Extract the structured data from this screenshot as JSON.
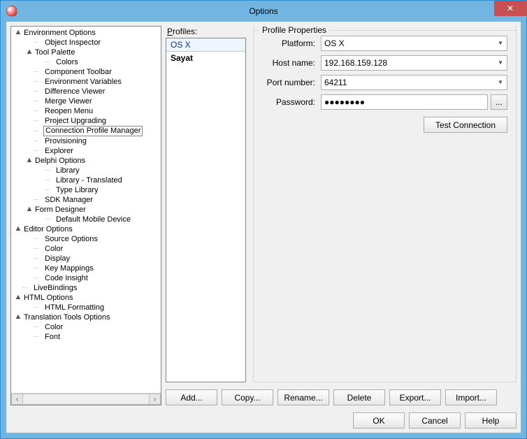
{
  "window": {
    "title": "Options"
  },
  "tree": {
    "selected_label": "Connection Profile Manager",
    "nodes": [
      {
        "label": "Environment Options",
        "depth": 0,
        "expander": "▲",
        "dots": false
      },
      {
        "label": "Object Inspector",
        "depth": 1,
        "expander": "",
        "dots": true
      },
      {
        "label": "Tool Palette",
        "depth": 1,
        "expander": "▲",
        "dots": false
      },
      {
        "label": "Colors",
        "depth": 2,
        "expander": "",
        "dots": true
      },
      {
        "label": "Component Toolbar",
        "depth": 1,
        "expander": "",
        "dots": true
      },
      {
        "label": "Environment Variables",
        "depth": 1,
        "expander": "",
        "dots": true
      },
      {
        "label": "Difference Viewer",
        "depth": 1,
        "expander": "",
        "dots": true
      },
      {
        "label": "Merge Viewer",
        "depth": 1,
        "expander": "",
        "dots": true
      },
      {
        "label": "Reopen Menu",
        "depth": 1,
        "expander": "",
        "dots": true
      },
      {
        "label": "Project Upgrading",
        "depth": 1,
        "expander": "",
        "dots": true
      },
      {
        "label": "Connection Profile Manager",
        "depth": 1,
        "expander": "",
        "dots": true,
        "selected": true
      },
      {
        "label": "Provisioning",
        "depth": 1,
        "expander": "",
        "dots": true
      },
      {
        "label": "Explorer",
        "depth": 1,
        "expander": "",
        "dots": true
      },
      {
        "label": "Delphi Options",
        "depth": 1,
        "expander": "▲",
        "dots": false
      },
      {
        "label": "Library",
        "depth": 2,
        "expander": "",
        "dots": true
      },
      {
        "label": "Library - Translated",
        "depth": 2,
        "expander": "",
        "dots": true
      },
      {
        "label": "Type Library",
        "depth": 2,
        "expander": "",
        "dots": true
      },
      {
        "label": "SDK Manager",
        "depth": 1,
        "expander": "",
        "dots": true
      },
      {
        "label": "Form Designer",
        "depth": 1,
        "expander": "▲",
        "dots": false
      },
      {
        "label": "Default Mobile Device",
        "depth": 2,
        "expander": "",
        "dots": true
      },
      {
        "label": "Editor Options",
        "depth": 0,
        "expander": "▲",
        "dots": false
      },
      {
        "label": "Source Options",
        "depth": 1,
        "expander": "",
        "dots": true
      },
      {
        "label": "Color",
        "depth": 1,
        "expander": "",
        "dots": true
      },
      {
        "label": "Display",
        "depth": 1,
        "expander": "",
        "dots": true
      },
      {
        "label": "Key Mappings",
        "depth": 1,
        "expander": "",
        "dots": true
      },
      {
        "label": "Code Insight",
        "depth": 1,
        "expander": "",
        "dots": true
      },
      {
        "label": "LiveBindings",
        "depth": 0,
        "expander": "",
        "dots": true
      },
      {
        "label": "HTML Options",
        "depth": 0,
        "expander": "▲",
        "dots": false
      },
      {
        "label": "HTML Formatting",
        "depth": 1,
        "expander": "",
        "dots": true
      },
      {
        "label": "Translation Tools Options",
        "depth": 0,
        "expander": "▲",
        "dots": false
      },
      {
        "label": "Color",
        "depth": 1,
        "expander": "",
        "dots": true
      },
      {
        "label": "Font",
        "depth": 1,
        "expander": "",
        "dots": true
      }
    ]
  },
  "profiles": {
    "group_label_pre": "",
    "group_label_u": "P",
    "group_label_post": "rofiles:",
    "items": [
      {
        "name": "OS X",
        "selected": true,
        "bold": false
      },
      {
        "name": "Sayat",
        "selected": false,
        "bold": true
      }
    ]
  },
  "props": {
    "legend": "Profile Properties",
    "platform_label_pre": "Plat",
    "platform_label_u": "f",
    "platform_label_post": "orm:",
    "platform_value": "OS X",
    "host_label_pre": "",
    "host_label_u": "H",
    "host_label_post": "ost name:",
    "host_value": "192.168.159.128",
    "port_label_pre": "Port ",
    "port_label_u": "n",
    "port_label_post": "umber:",
    "port_value": "64211",
    "password_label_pre": "Pass",
    "password_label_u": "w",
    "password_label_post": "ord:",
    "password_value": "●●●●●●●●",
    "ellipsis": "...",
    "test_label": "Test Connection"
  },
  "actions": {
    "add": "Add...",
    "copy": "Copy...",
    "rename": "Rename...",
    "delete": "Delete",
    "export": "Export...",
    "import": "Import..."
  },
  "buttons": {
    "ok": "OK",
    "cancel": "Cancel",
    "help": "Help"
  }
}
